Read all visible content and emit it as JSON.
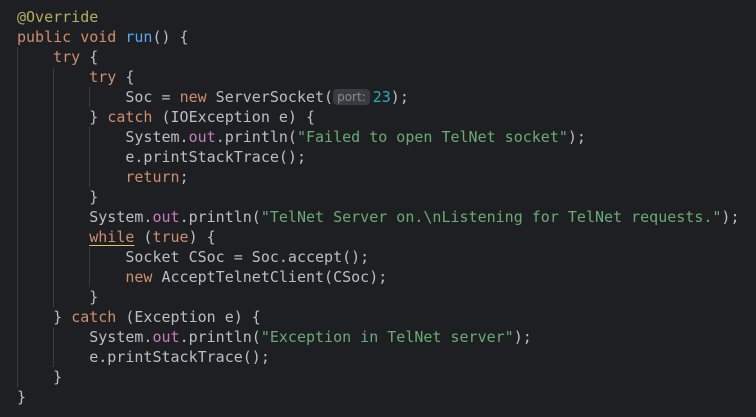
{
  "editor": {
    "language": "java",
    "theme_colors": {
      "background": "#1e1f22",
      "text": "#bcbec4",
      "keyword": "#cf8e6d",
      "string": "#6aab73",
      "number": "#2aacb8",
      "annotation": "#b3ae60",
      "static_field": "#c77dbb",
      "method_declaration": "#56a8f5",
      "inlay_hint_bg": "#393b40",
      "inlay_hint_text": "#868a91",
      "indent_guide": "#3a3c41"
    },
    "lines": [
      [
        {
          "t": "@Override",
          "c": "ann"
        }
      ],
      [
        {
          "t": "public",
          "c": "kw"
        },
        {
          "t": " "
        },
        {
          "t": "void",
          "c": "kw"
        },
        {
          "t": " "
        },
        {
          "t": "run",
          "c": "fn"
        },
        {
          "t": "() {"
        }
      ],
      [
        {
          "t": "    "
        },
        {
          "t": "try",
          "c": "kw"
        },
        {
          "t": " {"
        }
      ],
      [
        {
          "t": "        "
        },
        {
          "t": "try",
          "c": "kw"
        },
        {
          "t": " {"
        }
      ],
      [
        {
          "t": "            Soc = "
        },
        {
          "t": "new",
          "c": "kw"
        },
        {
          "t": " ServerSocket("
        },
        {
          "t": "port:",
          "c": "hint"
        },
        {
          "t": "23",
          "c": "num"
        },
        {
          "t": ");"
        }
      ],
      [
        {
          "t": "        } "
        },
        {
          "t": "catch",
          "c": "kw"
        },
        {
          "t": " (IOException e) {"
        }
      ],
      [
        {
          "t": "            System."
        },
        {
          "t": "out",
          "c": "field"
        },
        {
          "t": ".println("
        },
        {
          "t": "\"Failed to open TelNet socket\"",
          "c": "str"
        },
        {
          "t": ");"
        }
      ],
      [
        {
          "t": "            e.printStackTrace();"
        }
      ],
      [
        {
          "t": "            "
        },
        {
          "t": "return",
          "c": "kw"
        },
        {
          "t": ";"
        }
      ],
      [
        {
          "t": "        }"
        }
      ],
      [
        {
          "t": "        System."
        },
        {
          "t": "out",
          "c": "field"
        },
        {
          "t": ".println("
        },
        {
          "t": "\"TelNet Server on.\\nListening for TelNet requests.\"",
          "c": "str"
        },
        {
          "t": ");"
        }
      ],
      [
        {
          "t": "        "
        },
        {
          "t": "while",
          "c": "kw hl"
        },
        {
          "t": " ("
        },
        {
          "t": "true",
          "c": "kw"
        },
        {
          "t": ") {"
        }
      ],
      [
        {
          "t": "            Socket CSoc = Soc.accept();"
        }
      ],
      [
        {
          "t": "            "
        },
        {
          "t": "new",
          "c": "kw"
        },
        {
          "t": " AcceptTelnetClient(CSoc);"
        }
      ],
      [
        {
          "t": "        }"
        }
      ],
      [
        {
          "t": "    } "
        },
        {
          "t": "catch",
          "c": "kw"
        },
        {
          "t": " (Exception e) {"
        }
      ],
      [
        {
          "t": "        System."
        },
        {
          "t": "out",
          "c": "field"
        },
        {
          "t": ".println("
        },
        {
          "t": "\"Exception in TelNet server\"",
          "c": "str"
        },
        {
          "t": ");"
        }
      ],
      [
        {
          "t": "        e.printStackTrace();"
        }
      ],
      [
        {
          "t": "    }"
        }
      ],
      [
        {
          "t": "}"
        }
      ]
    ]
  }
}
